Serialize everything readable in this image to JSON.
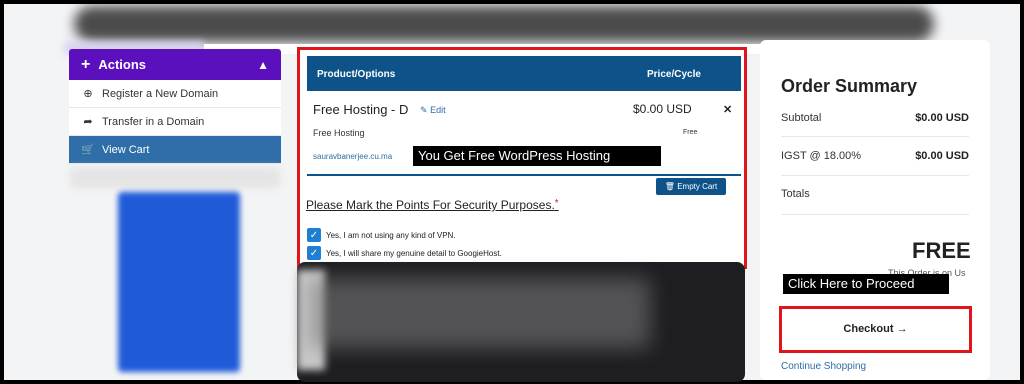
{
  "sidebar": {
    "actions_label": "Actions",
    "items": [
      {
        "label": "Register a New Domain",
        "icon": "globe-icon"
      },
      {
        "label": "Transfer in a Domain",
        "icon": "share-arrow-icon"
      },
      {
        "label": "View Cart",
        "icon": "cart-icon"
      }
    ]
  },
  "cart": {
    "col_product": "Product/Options",
    "col_price": "Price/Cycle",
    "product_name": "Free Hosting - D",
    "edit_label": "Edit",
    "price": "$0.00 USD",
    "product_sub": "Free Hosting",
    "cycle": "Free",
    "domain": "sauravbanerjee.cu.ma",
    "empty_cart_label": "Empty Cart",
    "security_heading": "Please Mark the Points For Security Purposes.",
    "checks": [
      "Yes, I am not using any kind of VPN.",
      "Yes, I will share my genuine detail to GoogieHost."
    ]
  },
  "annotations": {
    "wp_callout": "You Get Free WordPress Hosting",
    "proceed_callout": "Click Here to Proceed"
  },
  "summary": {
    "title": "Order Summary",
    "subtotal_label": "Subtotal",
    "subtotal_value": "$0.00 USD",
    "tax_label": "IGST @ 18.00%",
    "tax_value": "$0.00 USD",
    "totals_label": "Totals",
    "total_value": "FREE",
    "free_note": "This Order is on Us",
    "checkout_label": "Checkout →",
    "continue_label": "Continue Shopping"
  },
  "colors": {
    "accent_purple": "#5b0fbd",
    "table_blue": "#0d5288",
    "highlight_red": "#e0141b"
  }
}
